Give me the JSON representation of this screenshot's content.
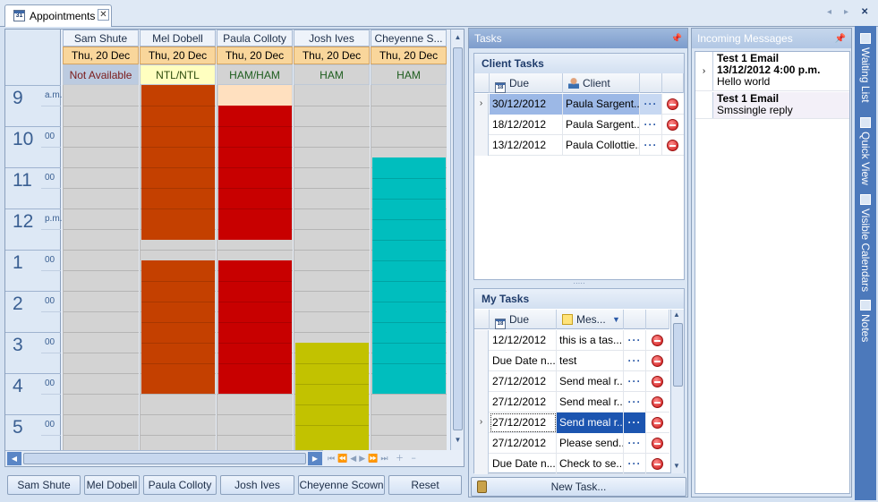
{
  "tab": {
    "label": "Appointments",
    "close_glyph": "✕",
    "cal_day": "31"
  },
  "tab_nav": {
    "prev": "◂",
    "next": "▸",
    "close": "✕"
  },
  "time_ruler": [
    {
      "hour": "9",
      "suffix": "a.m."
    },
    {
      "hour": "10",
      "suffix": "00"
    },
    {
      "hour": "11",
      "suffix": "00"
    },
    {
      "hour": "12",
      "suffix": "p.m."
    },
    {
      "hour": "1",
      "suffix": "00"
    },
    {
      "hour": "2",
      "suffix": "00"
    },
    {
      "hour": "3",
      "suffix": "00"
    },
    {
      "hour": "4",
      "suffix": "00"
    },
    {
      "hour": "5",
      "suffix": "00"
    }
  ],
  "resources": [
    {
      "name": "Sam Shute",
      "date": "Thu, 20 Dec",
      "status": "Not Available",
      "status_bg": "#bccbe0",
      "status_color": "#7a1a1a",
      "appointments": []
    },
    {
      "name": "Mel Dobell",
      "date": "Thu, 20 Dec",
      "status": "NTL/NTL",
      "status_bg": "#ffffc0",
      "status_color": "#2c4a0c",
      "appointments": [
        {
          "start": 9.0,
          "end": 12.75,
          "color": "#c44000"
        },
        {
          "start": 13.25,
          "end": 16.5,
          "color": "#c44000"
        }
      ]
    },
    {
      "name": "Paula Colloty",
      "date": "Thu, 20 Dec",
      "status": "HAM/HAM",
      "status_bg": "#d3d3d3",
      "status_color": "#1d5c1d",
      "appointments": [
        {
          "start": 9.0,
          "end": 9.5,
          "color": "#ffe0bf"
        },
        {
          "start": 9.5,
          "end": 12.75,
          "color": "#c80000"
        },
        {
          "start": 13.25,
          "end": 16.5,
          "color": "#c80000"
        }
      ]
    },
    {
      "name": "Josh Ives",
      "date": "Thu, 20 Dec",
      "status": "HAM",
      "status_bg": "#d3d3d3",
      "status_color": "#1d5c1d",
      "appointments": [
        {
          "start": 15.25,
          "end": 18.0,
          "color": "#c2c200"
        }
      ]
    },
    {
      "name": "Cheyenne S...",
      "date": "Thu, 20 Dec",
      "status": "HAM",
      "status_bg": "#d3d3d3",
      "status_color": "#1d5c1d",
      "appointments": [
        {
          "start": 10.75,
          "end": 16.5,
          "color": "#00bebe"
        }
      ]
    }
  ],
  "resource_buttons": [
    "Sam Shute",
    "Mel Dobell",
    "Paula Colloty",
    "Josh Ives",
    "Cheyenne Scown",
    "Reset"
  ],
  "tasks_panel": {
    "title": "Tasks",
    "client_tasks": {
      "title": "Client Tasks",
      "columns": {
        "due": "Due",
        "client": "Client"
      },
      "rows": [
        {
          "due": "30/12/2012",
          "client": "Paula Sargent...",
          "action": "···",
          "selected": true
        },
        {
          "due": "18/12/2012",
          "client": "Paula Sargent...",
          "action": "···",
          "selected": false
        },
        {
          "due": "13/12/2012",
          "client": "Paula Collottie...",
          "action": "···",
          "selected": false
        }
      ]
    },
    "my_tasks": {
      "title": "My Tasks",
      "columns": {
        "due": "Due",
        "message": "Mes..."
      },
      "rows": [
        {
          "due": "12/12/2012",
          "message": "this is a tas...",
          "action": "···",
          "selected": false
        },
        {
          "due": "Due Date n...",
          "message": "test",
          "action": "···",
          "selected": false
        },
        {
          "due": "27/12/2012",
          "message": "Send meal r...",
          "action": "···",
          "selected": false
        },
        {
          "due": "27/12/2012",
          "message": "Send meal r...",
          "action": "···",
          "selected": false
        },
        {
          "due": "27/12/2012",
          "message": "Send meal r...",
          "action": "···",
          "selected": true
        },
        {
          "due": "27/12/2012",
          "message": "Please send...",
          "action": "···",
          "selected": false
        },
        {
          "due": "Due Date n...",
          "message": "Check to se...",
          "action": "···",
          "selected": false
        }
      ]
    },
    "new_task_label": "New Task..."
  },
  "messages_panel": {
    "title": "Incoming Messages",
    "messages": [
      {
        "line1": "Test 1 Email",
        "line2": "13/12/2012 4:00 p.m.",
        "line3": "Hello world"
      },
      {
        "line1": "Test 1 Email",
        "line2": "Smssingle reply",
        "line3": ""
      }
    ]
  },
  "right_tabs": [
    "Waiting List",
    "Quick View",
    "Visible Calendars",
    "Notes"
  ],
  "colors": {
    "accent": "#4c79bb",
    "header": "#8ba0bc",
    "selected_row": "#1c55b0"
  }
}
